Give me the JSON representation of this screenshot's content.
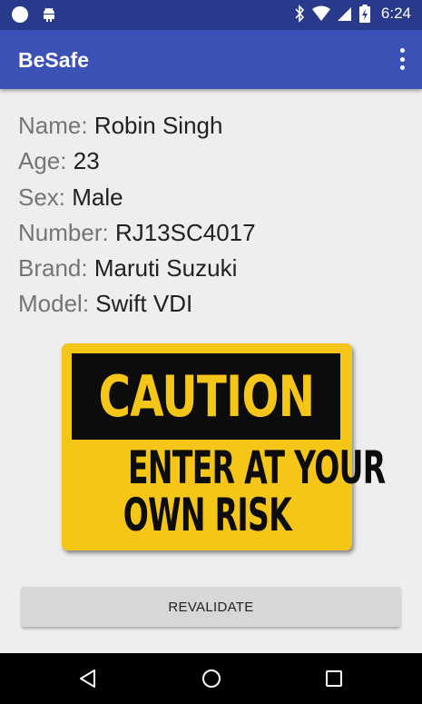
{
  "status_bar": {
    "time": "6:24",
    "icons": [
      "circle-notification-icon",
      "android-icon",
      "bluetooth-icon",
      "wifi-icon",
      "signal-icon",
      "battery-icon"
    ]
  },
  "app_bar": {
    "title": "BeSafe",
    "menu_icon": "more-vert-icon"
  },
  "info": {
    "name_label": "Name:",
    "name_value": "Robin Singh",
    "age_label": "Age:",
    "age_value": "23",
    "sex_label": "Sex:",
    "sex_value": "Male",
    "number_label": "Number:",
    "number_value": "RJ13SC4017",
    "brand_label": "Brand:",
    "brand_value": "Maruti Suzuki",
    "model_label": "Model:",
    "model_value": "Swift VDI"
  },
  "sign": {
    "headline": "CAUTION",
    "line1": "ENTER AT YOUR",
    "line2": "OWN RISK",
    "colors": {
      "yellow": "#f5c518",
      "black": "#0c0c0c"
    }
  },
  "actions": {
    "revalidate_label": "REVALIDATE"
  },
  "colors": {
    "status_bar": "#293a8c",
    "app_bar": "#3b51b5",
    "background": "#eeeeee",
    "button": "#d6d7d7"
  },
  "nav_bar": {
    "buttons": [
      "back-icon",
      "home-icon",
      "recents-icon"
    ]
  }
}
